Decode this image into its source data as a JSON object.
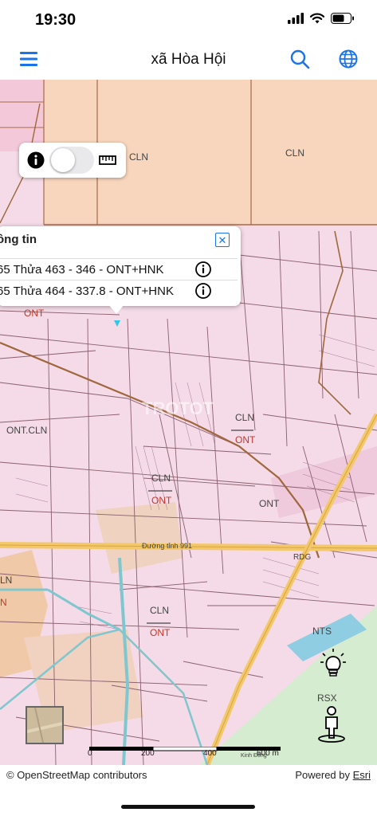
{
  "status_bar": {
    "time": "19:30"
  },
  "nav": {
    "title": "xã Hòa Hội"
  },
  "popup": {
    "title": "ông tin",
    "rows": [
      {
        "text": "65 Thửa 463 - 346 - ONT+HNK"
      },
      {
        "text": "65 Thửa 464 - 337.8 - ONT+HNK"
      }
    ]
  },
  "map_labels": {
    "cln_top_left": "CLN",
    "cln_top_right": "CLN",
    "ont_a": "ONT",
    "ont_cln": "ONT.CLN",
    "cln_b": "CLN",
    "ont_b": "ONT",
    "cln_c": "CLN",
    "ont_c": "ONT",
    "ont_d": "ONT",
    "road": "Đường tỉnh 991",
    "rdg": "RDG",
    "cln_d": "CLN",
    "ont_e": "ONT",
    "nts": "NTS",
    "rsx": "RSX",
    "ln_left": "LN",
    "n_left": "N",
    "watermark": "TROTOT",
    "kinh_dong": "Kinh Đông"
  },
  "scale": {
    "labels": [
      "0",
      "200",
      "400",
      "600 m"
    ]
  },
  "footer": {
    "attribution": "© OpenStreetMap contributors",
    "powered_prefix": "Powered by ",
    "powered_link": "Esri"
  },
  "icons": {
    "menu": "hamburger-icon",
    "search": "search-icon",
    "globe": "globe-icon",
    "info": "info-icon",
    "ruler": "ruler-icon",
    "close": "close-icon",
    "lightbulb": "lightbulb-icon",
    "streetview": "person-icon"
  },
  "colors": {
    "accent": "#1a73e8",
    "parcel_pink": "#f4dbe7",
    "parcel_peach": "#f8d5bd",
    "parcel_green": "#d5ecd0",
    "road_yellow": "#f3c86b",
    "water_blue": "#8fcde3"
  }
}
